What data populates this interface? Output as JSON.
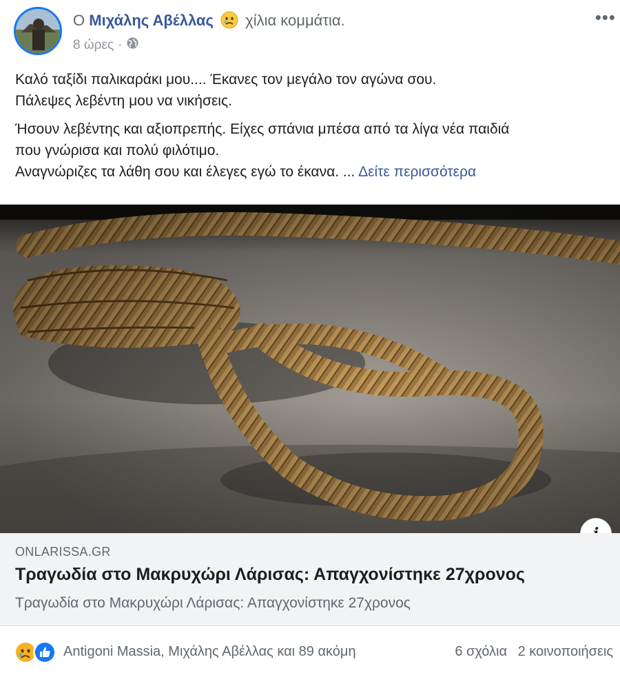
{
  "post": {
    "title_prefix": "Ο",
    "author": "Μιχάλης Αβέλλας",
    "feeling": "χίλια κομμάτια.",
    "time": "8 ώρες",
    "time_separator": "·",
    "audience_icon": "globe-icon",
    "more_label": "•••",
    "paragraphs": [
      "Καλό ταξίδι παλικαράκι μου.... Έκανες τον μεγάλο τον αγώνα σου.",
      "Πάλεψες λεβέντη μου να νικήσεις.",
      "Ήσουν λεβέντης και αξιοπρεπής. Είχες σπάνια μπέσα από τα λίγα νέα παιδιά",
      "που γνώρισα και πολύ φιλότιμο.",
      "Αναγνώριζες τα λάθη σου και έλεγες εγώ το έκανα. ..."
    ],
    "see_more": "Δείτε περισσότερα"
  },
  "link": {
    "domain": "ONLARISSA.GR",
    "title": "Τραγωδία στο Μακρυχώρι Λάρισας: Απαγχονίστηκε 27χρονος",
    "subtitle": "Τραγωδία στο Μακρυχώρι Λάρισας: Απαγχονίστηκε 27χρονος",
    "info_label": "i"
  },
  "footer": {
    "reaction_icons": [
      "sad-reaction-icon",
      "like-reaction-icon"
    ],
    "reactors": "Antigoni Massia, Μιχάλης Αβέλλας και 89 ακόμη",
    "comments": "6 σχόλια",
    "shares": "2 κοινοποιήσεις"
  },
  "colors": {
    "link_blue": "#385898",
    "meta_gray": "#606770",
    "link_box_bg": "#f2f3f5",
    "like_blue": "#1877f2",
    "sad_yellow": "#f7b125"
  }
}
